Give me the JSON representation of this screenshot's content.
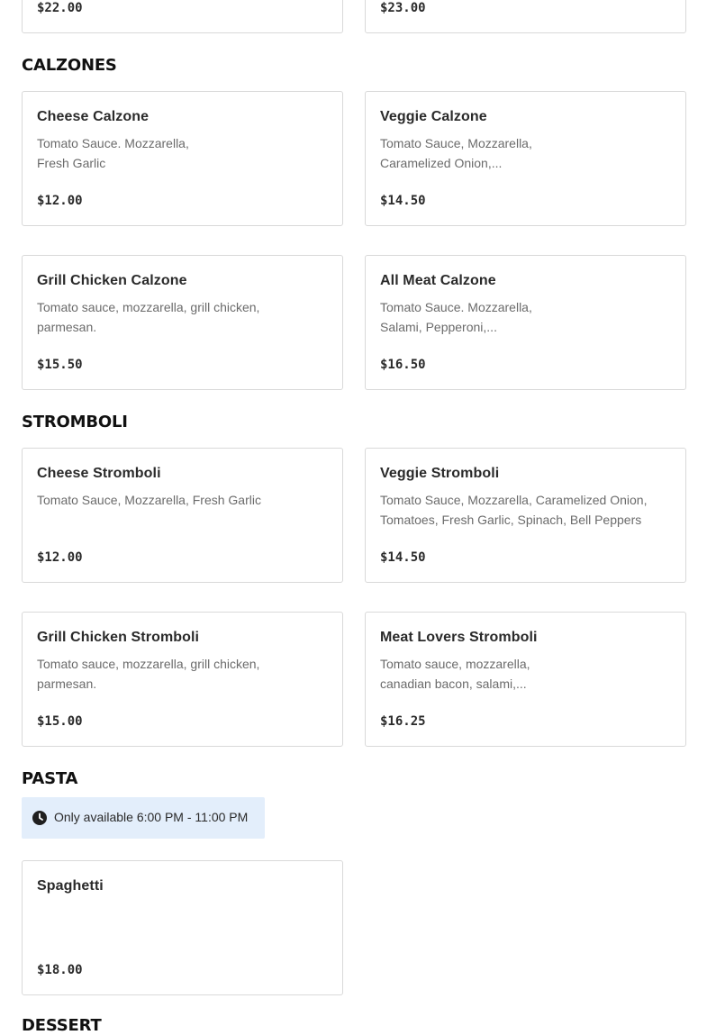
{
  "top_prices": {
    "left": "$22.00",
    "right": "$23.00"
  },
  "sections": {
    "calzones": {
      "title": "CALZONES",
      "items": [
        {
          "name": "Cheese Calzone",
          "desc": "Tomato Sauce. Mozzarella,\nFresh Garlic",
          "price": "$12.00"
        },
        {
          "name": "Veggie Calzone",
          "desc": "Tomato Sauce, Mozzarella,\nCaramelized Onion,...",
          "price": "$14.50"
        },
        {
          "name": "Grill Chicken Calzone",
          "desc": "Tomato sauce, mozzarella, grill chicken,\nparmesan.",
          "price": "$15.50"
        },
        {
          "name": "All Meat Calzone",
          "desc": "Tomato Sauce. Mozzarella,\nSalami, Pepperoni,...",
          "price": "$16.50"
        }
      ]
    },
    "stromboli": {
      "title": "STROMBOLI",
      "items": [
        {
          "name": "Cheese Stromboli",
          "desc": "Tomato Sauce, Mozzarella, Fresh Garlic",
          "price": "$12.00"
        },
        {
          "name": "Veggie Stromboli",
          "desc": "Tomato Sauce, Mozzarella, Caramelized Onion,\nTomatoes, Fresh Garlic, Spinach, Bell Peppers",
          "price": "$14.50"
        },
        {
          "name": "Grill Chicken Stromboli",
          "desc": "Tomato sauce, mozzarella, grill chicken,\nparmesan.",
          "price": "$15.00"
        },
        {
          "name": "Meat Lovers Stromboli",
          "desc": "Tomato sauce, mozzarella,\ncanadian bacon, salami,...",
          "price": "$16.25"
        }
      ]
    },
    "pasta": {
      "title": "PASTA",
      "availability": "Only available 6:00 PM - 11:00 PM",
      "items": [
        {
          "name": "Spaghetti",
          "desc": "",
          "price": "$18.00"
        }
      ]
    },
    "dessert": {
      "title": "DESSERT"
    }
  },
  "icons": {
    "availability_icon": "clock-icon"
  },
  "colors": {
    "availability_bg": "#e3eefb",
    "card_border": "#d9d9d9"
  }
}
